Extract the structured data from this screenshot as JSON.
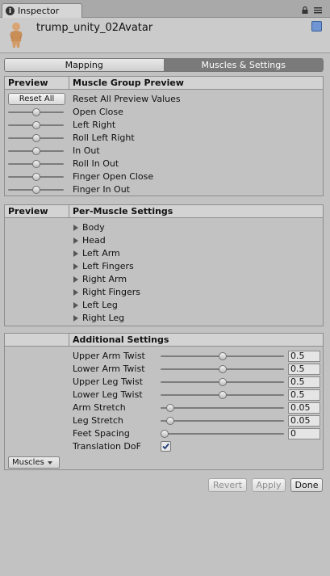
{
  "window": {
    "tab_label": "Inspector",
    "tab_icon": "inspector-icon"
  },
  "header": {
    "asset_name": "trump_unity_02Avatar"
  },
  "toolbar": {
    "mapping_label": "Mapping",
    "muscles_label": "Muscles & Settings"
  },
  "preview_section": {
    "col_left": "Preview",
    "col_right": "Muscle Group Preview",
    "reset_button": "Reset All",
    "reset_label": "Reset All Preview Values",
    "groups": [
      "Open Close",
      "Left Right",
      "Roll Left Right",
      "In Out",
      "Roll In Out",
      "Finger Open Close",
      "Finger In Out"
    ]
  },
  "per_muscle_section": {
    "col_left": "Preview",
    "col_right": "Per-Muscle Settings",
    "items": [
      "Body",
      "Head",
      "Left Arm",
      "Left Fingers",
      "Right Arm",
      "Right Fingers",
      "Left Leg",
      "Right Leg"
    ]
  },
  "additional_section": {
    "title": "Additional Settings",
    "settings": [
      {
        "label": "Upper Arm Twist",
        "value": "0.5",
        "fraction": 0.5
      },
      {
        "label": "Lower Arm Twist",
        "value": "0.5",
        "fraction": 0.5
      },
      {
        "label": "Upper Leg Twist",
        "value": "0.5",
        "fraction": 0.5
      },
      {
        "label": "Lower Leg Twist",
        "value": "0.5",
        "fraction": 0.5
      },
      {
        "label": "Arm Stretch",
        "value": "0.05",
        "fraction": 0.05
      },
      {
        "label": "Leg Stretch",
        "value": "0.05",
        "fraction": 0.05
      },
      {
        "label": "Feet Spacing",
        "value": "0",
        "fraction": 0
      }
    ],
    "translation_dof_label": "Translation DoF",
    "translation_dof_checked": true,
    "muscles_dropdown": "Muscles"
  },
  "footer": {
    "revert": "Revert",
    "apply": "Apply",
    "done": "Done"
  }
}
